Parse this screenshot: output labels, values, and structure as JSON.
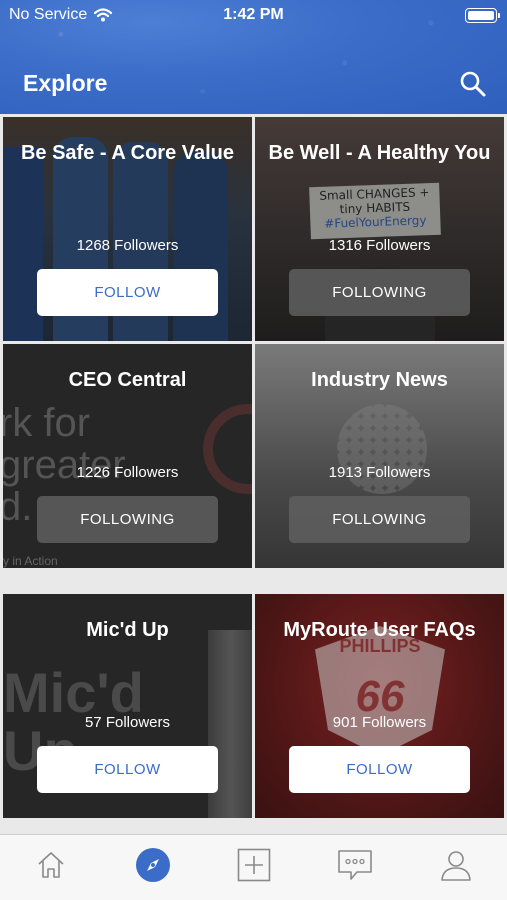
{
  "status_bar": {
    "carrier": "No Service",
    "time": "1:42 PM"
  },
  "header": {
    "title": "Explore",
    "search_icon": "search-icon"
  },
  "tiles": [
    {
      "name": "Be Safe - A Core Value",
      "followers": "1268 Followers",
      "button": "FOLLOW"
    },
    {
      "name": "Be Well - A Healthy You",
      "followers": "1316 Followers",
      "button": "FOLLOWING"
    },
    {
      "name": "CEO Central",
      "followers": "1226 Followers",
      "button": "FOLLOWING"
    },
    {
      "name": "Industry News",
      "followers": "1913 Followers",
      "button": "FOLLOWING"
    },
    {
      "name": "Mic'd Up",
      "followers": "57 Followers",
      "button": "FOLLOW"
    },
    {
      "name": "MyRoute User FAQs",
      "followers": "901 Followers",
      "button": "FOLLOW"
    }
  ],
  "background_text": {
    "tile2_sign_1": "Small CHANGES +",
    "tile2_sign_2": "tiny HABITS",
    "tile2_sign_3": "#FuelYourEnergy",
    "tile3_big_1": "rk for",
    "tile3_big_2": "greater",
    "tile3_big_3": "d.",
    "tile3_small": "y in Action",
    "tile5_big_1": "Mic'd",
    "tile5_big_2": "Up",
    "tile6_logo_top": "PHILLIPS",
    "tile6_logo_num": "66"
  },
  "tab_bar": [
    "home-icon",
    "explore-compass-icon",
    "add-post-icon",
    "messages-icon",
    "profile-icon"
  ],
  "colors": {
    "accent": "#3a6cc8",
    "header": "#3a6cc8",
    "following_btn": "#5f5f5f"
  }
}
